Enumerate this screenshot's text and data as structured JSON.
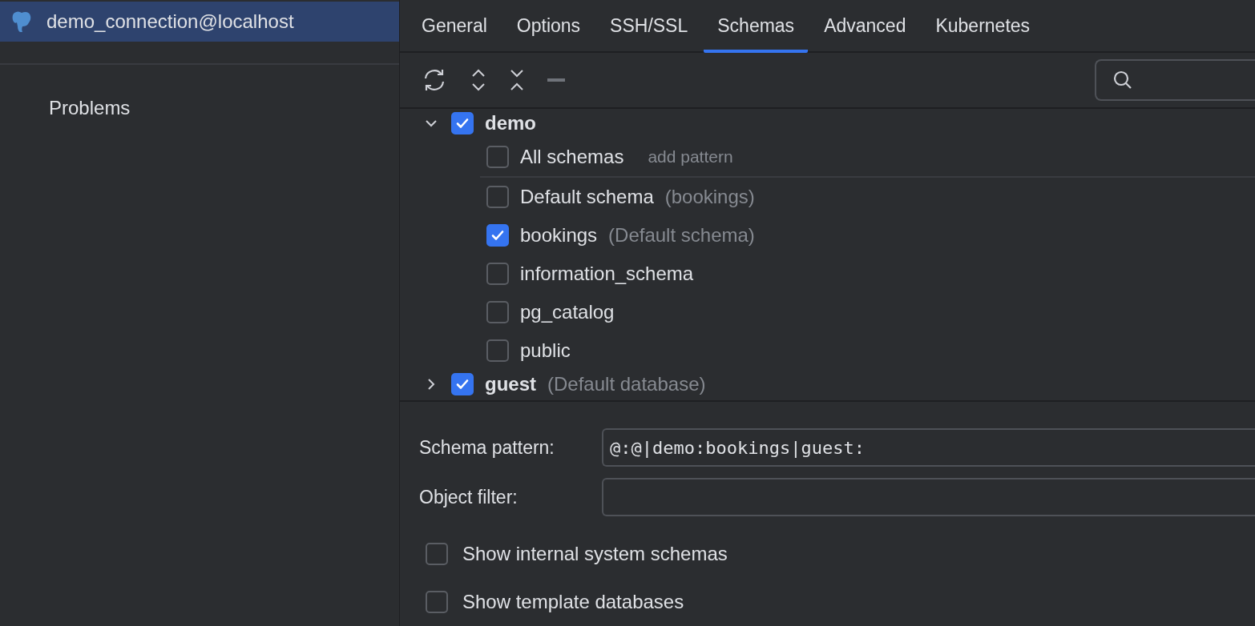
{
  "sidebar": {
    "items": [
      {
        "label": "demo_connection@localhost",
        "kind": "connection",
        "selected": true
      },
      {
        "label": "Problems",
        "kind": "section",
        "selected": false
      }
    ]
  },
  "tabs": [
    {
      "label": "General",
      "selected": false
    },
    {
      "label": "Options",
      "selected": false
    },
    {
      "label": "SSH/SSL",
      "selected": false
    },
    {
      "label": "Schemas",
      "selected": true
    },
    {
      "label": "Advanced",
      "selected": false
    },
    {
      "label": "Kubernetes",
      "selected": false
    }
  ],
  "tree": [
    {
      "name": "demo",
      "checked": true,
      "expanded": true,
      "children": [
        {
          "name": "All schemas",
          "hint": "add pattern",
          "checked": false,
          "separated": true
        },
        {
          "name": "Default schema",
          "note": "(bookings)",
          "checked": false
        },
        {
          "name": "bookings",
          "note": "(Default schema)",
          "checked": true
        },
        {
          "name": "information_schema",
          "checked": false
        },
        {
          "name": "pg_catalog",
          "checked": false
        },
        {
          "name": "public",
          "checked": false
        }
      ]
    },
    {
      "name": "guest",
      "note": "(Default database)",
      "checked": true,
      "expanded": false
    }
  ],
  "fields": [
    {
      "label": "Schema pattern:",
      "value": "@:@|demo:bookings|guest:"
    },
    {
      "label": "Object filter:"
    }
  ],
  "options": [
    {
      "label": "Show internal system schemas",
      "checked": false
    },
    {
      "label": "Show template databases",
      "checked": false
    }
  ]
}
